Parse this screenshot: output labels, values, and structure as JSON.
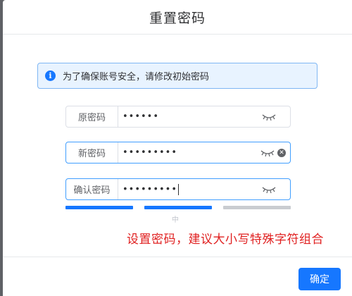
{
  "dialog": {
    "title": "重置密码",
    "notice": {
      "icon": "info-icon",
      "text": "为了确保账号安全，请修改初始密码"
    },
    "fields": [
      {
        "label": "原密码",
        "value": "••••••",
        "icon": "eye-closed-icon"
      },
      {
        "label": "新密码",
        "value": "•••••••••",
        "icon": "eye-closed-icon",
        "clear_icon": "clear-icon"
      },
      {
        "label": "确认密码",
        "value": "•••••••••",
        "icon": "eye-closed-icon"
      }
    ],
    "strength": {
      "level": 2,
      "max": 3,
      "label": "中",
      "active_color": "#1677ff",
      "inactive_color": "#c9ccd1"
    },
    "hint": "设置密码，建议大小写特殊字符组合",
    "confirm_label": "确定"
  },
  "colors": {
    "accent": "#1677ff",
    "hint": "#e02020"
  }
}
